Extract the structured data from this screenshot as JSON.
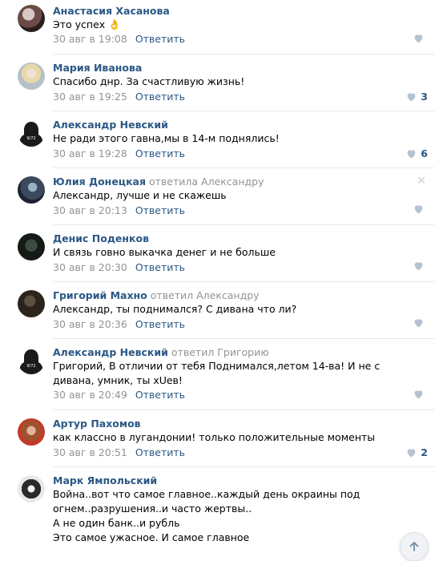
{
  "comments": [
    {
      "author": "Анастасия Хасанова",
      "reply_to": "",
      "text": "Это успех 👌",
      "date": "30 авг в 19:08",
      "reply_label": "Ответить",
      "likes": "",
      "avatar_icon": "user-avatar"
    },
    {
      "author": "Мария Иванова",
      "reply_to": "",
      "text": "Спасибо днр. За счастливую жизнь!",
      "date": "30 авг в 19:25",
      "reply_label": "Ответить",
      "likes": "3",
      "avatar_icon": "user-avatar"
    },
    {
      "author": "Александр Невский",
      "reply_to": "",
      "text": "Не ради этого гавна,мы в 14-м поднялись!",
      "date": "30 авг в 19:28",
      "reply_label": "Ответить",
      "likes": "6",
      "avatar_icon": "user-avatar"
    },
    {
      "author": "Юлия Донецкая",
      "reply_to": "ответила Александру",
      "text": "Александр, лучше и не скажешь",
      "date": "30 авг в 20:13",
      "reply_label": "Ответить",
      "likes": "",
      "avatar_icon": "user-avatar"
    },
    {
      "author": "Денис Поденков",
      "reply_to": "",
      "text": "И связь говно выкачка денег и не больше",
      "date": "30 авг в 20:30",
      "reply_label": "Ответить",
      "likes": "",
      "avatar_icon": "user-avatar"
    },
    {
      "author": "Григорий Махно",
      "reply_to": "ответил Александру",
      "text": "Александр, ты поднимался? С дивана что ли?",
      "date": "30 авг в 20:36",
      "reply_label": "Ответить",
      "likes": "",
      "avatar_icon": "user-avatar"
    },
    {
      "author": "Александр Невский",
      "reply_to": "ответил Григорию",
      "text": "Григорий, В отличии от тебя Поднимался,летом 14-ва! И не с дивана, умник, ты хUeв!",
      "date": "30 авг в 20:49",
      "reply_label": "Ответить",
      "likes": "",
      "avatar_icon": "user-avatar"
    },
    {
      "author": "Артур Пахомов",
      "reply_to": "",
      "text": "как классно в лугандонии! только положительные моменты",
      "date": "30 авг в 20:51",
      "reply_label": "Ответить",
      "likes": "2",
      "avatar_icon": "user-avatar"
    },
    {
      "author": "Марк Ямпольский",
      "reply_to": "",
      "text": "Война..вот что самое главное..каждый день окраины под огнем..разрушения..и часто жертвы..\nА не один банк..и рубль\nЭто самое ужасное. И самое главное",
      "date": "",
      "reply_label": "",
      "likes": "",
      "avatar_icon": "user-avatar"
    }
  ],
  "colors": {
    "link": "#2a5885",
    "meta": "#939393",
    "divider": "#e7e8ec",
    "like_icon": "#b5c2d1"
  },
  "icons": {
    "like": "heart-icon",
    "close": "close-icon",
    "scroll_top": "arrow-up-icon"
  }
}
